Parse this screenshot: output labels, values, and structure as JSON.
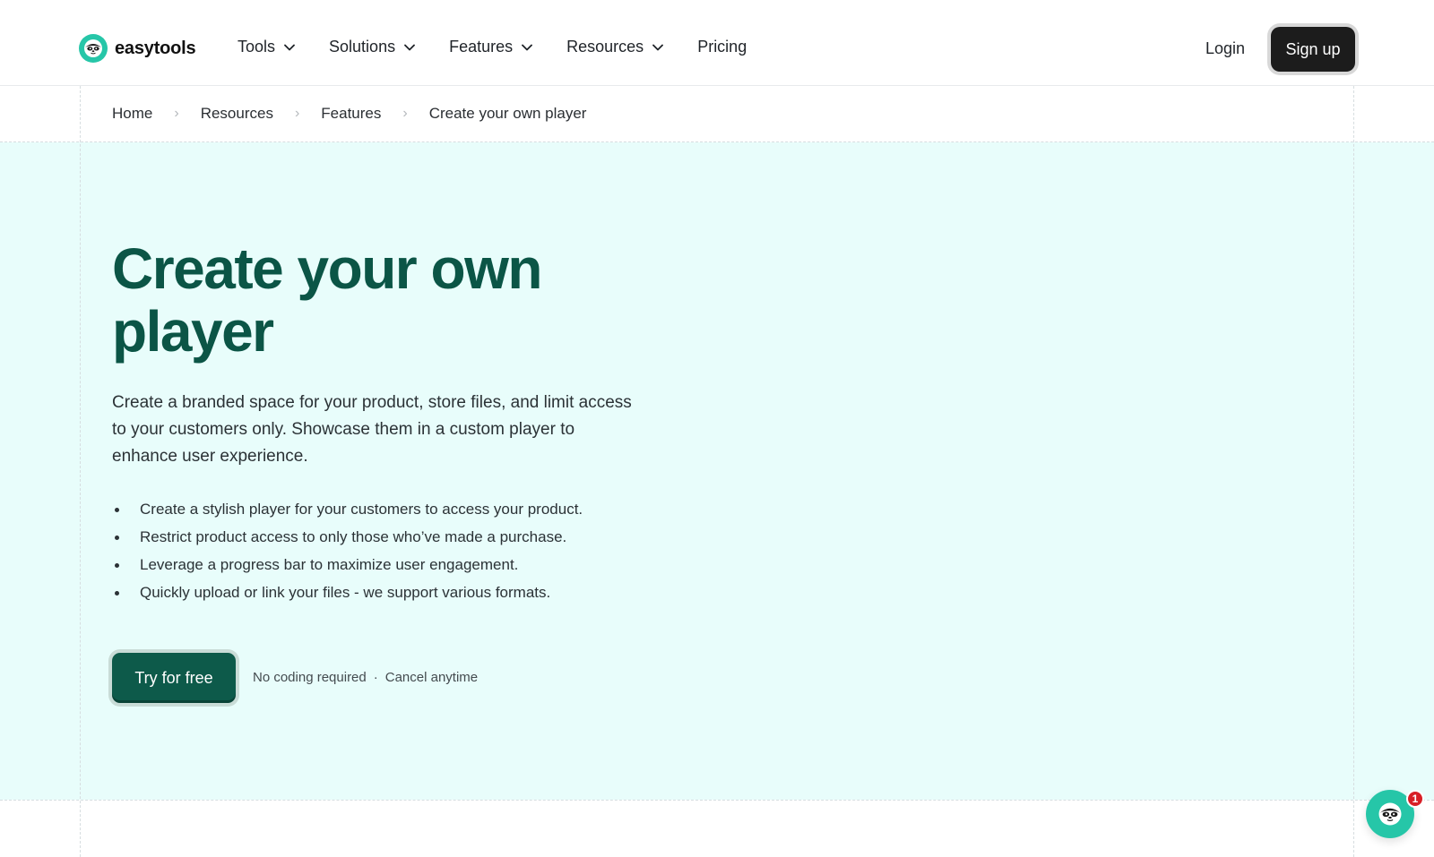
{
  "brand": {
    "name": "easytools"
  },
  "nav": {
    "items": [
      {
        "label": "Tools",
        "has_dropdown": true
      },
      {
        "label": "Solutions",
        "has_dropdown": true
      },
      {
        "label": "Features",
        "has_dropdown": true
      },
      {
        "label": "Resources",
        "has_dropdown": true
      },
      {
        "label": "Pricing",
        "has_dropdown": false
      }
    ],
    "login": "Login",
    "signup": "Sign up"
  },
  "breadcrumb": {
    "items": [
      "Home",
      "Resources",
      "Features"
    ],
    "current": "Create your own player"
  },
  "hero": {
    "title": "Create your own player",
    "description": "Create a branded space for your product, store files, and limit access to your customers only. Showcase them in a custom player to enhance user experience.",
    "bullets": [
      "Create a stylish player for your customers to access your product.",
      "Restrict product access to only those who’ve made a purchase.",
      "Leverage a progress bar to maximize user engagement.",
      "Quickly upload or link your files - we support various formats."
    ],
    "cta": "Try for free",
    "note_1": "No coding required",
    "note_sep": "·",
    "note_2": "Cancel anytime"
  },
  "chat": {
    "badge_count": "1",
    "icon": "sloth-chat-icon"
  },
  "colors": {
    "brand_teal": "#26c6a8",
    "heading_green": "#0b5546",
    "cta_green": "#0d5a4a",
    "hero_bg": "#e8fdfb",
    "signup_bg": "#1c1c1c",
    "badge_red": "#d81f26"
  }
}
